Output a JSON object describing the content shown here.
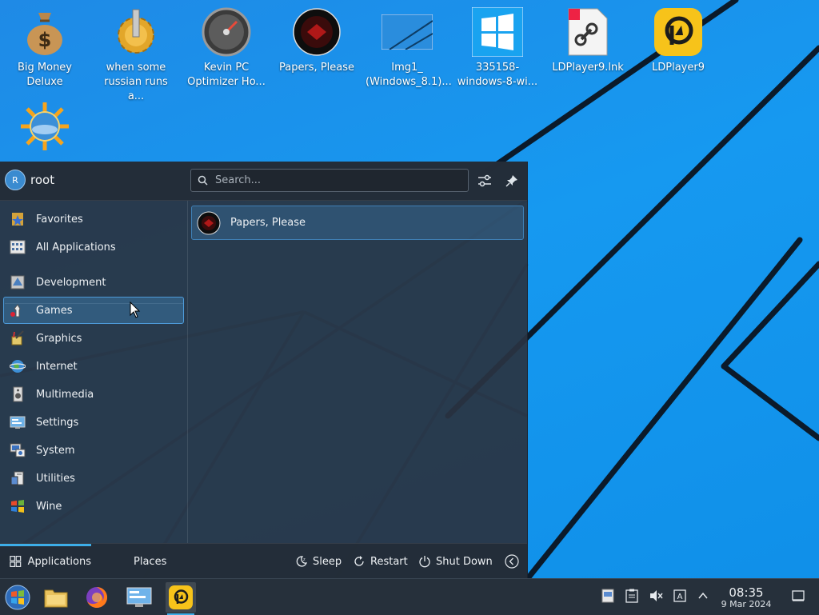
{
  "desktop": {
    "icons": [
      {
        "label": "Big Money Deluxe",
        "icon": "money-bag-icon"
      },
      {
        "label": "when some russian runs a...",
        "icon": "gear-icon"
      },
      {
        "label": "Kevin PC Optimizer Ho...",
        "icon": "speedometer-icon"
      },
      {
        "label": "Papers, Please",
        "icon": "papers-please-icon"
      },
      {
        "label": "Img1_ (Windows_8.1)...",
        "icon": "image-icon"
      },
      {
        "label": "335158-windows-8-wi...",
        "icon": "windows-logo-icon"
      },
      {
        "label": "LDPlayer9.lnk",
        "icon": "link-file-icon"
      },
      {
        "label": "LDPlayer9",
        "icon": "ldplayer-icon"
      },
      {
        "label": "",
        "icon": "sun-globe-icon"
      }
    ]
  },
  "launcher": {
    "user": {
      "initial": "R",
      "name": "root"
    },
    "search": {
      "placeholder": "Search..."
    },
    "categories": [
      {
        "label": "Favorites",
        "icon": "favorites-icon"
      },
      {
        "label": "All Applications",
        "icon": "all-applications-icon"
      },
      {
        "label": "Development",
        "icon": "development-icon"
      },
      {
        "label": "Games",
        "icon": "games-icon",
        "active": true
      },
      {
        "label": "Graphics",
        "icon": "graphics-icon"
      },
      {
        "label": "Internet",
        "icon": "internet-icon"
      },
      {
        "label": "Multimedia",
        "icon": "multimedia-icon"
      },
      {
        "label": "Settings",
        "icon": "settings-icon"
      },
      {
        "label": "System",
        "icon": "system-icon"
      },
      {
        "label": "Utilities",
        "icon": "utilities-icon"
      },
      {
        "label": "Wine",
        "icon": "wine-icon"
      }
    ],
    "results": [
      {
        "label": "Papers, Please",
        "icon": "papers-please-icon"
      }
    ],
    "footer": {
      "tabs": [
        {
          "label": "Applications",
          "active": true
        },
        {
          "label": "Places",
          "active": false
        }
      ],
      "sleep": "Sleep",
      "restart": "Restart",
      "shutdown": "Shut Down"
    }
  },
  "taskbar": {
    "apps": [
      "start-menu-icon",
      "file-manager-icon",
      "firefox-icon",
      "system-settings-icon",
      "ldplayer-icon"
    ],
    "tray": [
      "wine-tray-icon",
      "clipboard-icon",
      "volume-muted-icon",
      "keyboard-layout-icon",
      "expand-tray-icon",
      "show-desktop-icon"
    ],
    "clock": {
      "time": "08:35",
      "date": "9 Mar 2024"
    }
  },
  "colors": {
    "accent": "#3daee9",
    "wallpaper": "#1699f0",
    "panel": "#2a3442"
  }
}
